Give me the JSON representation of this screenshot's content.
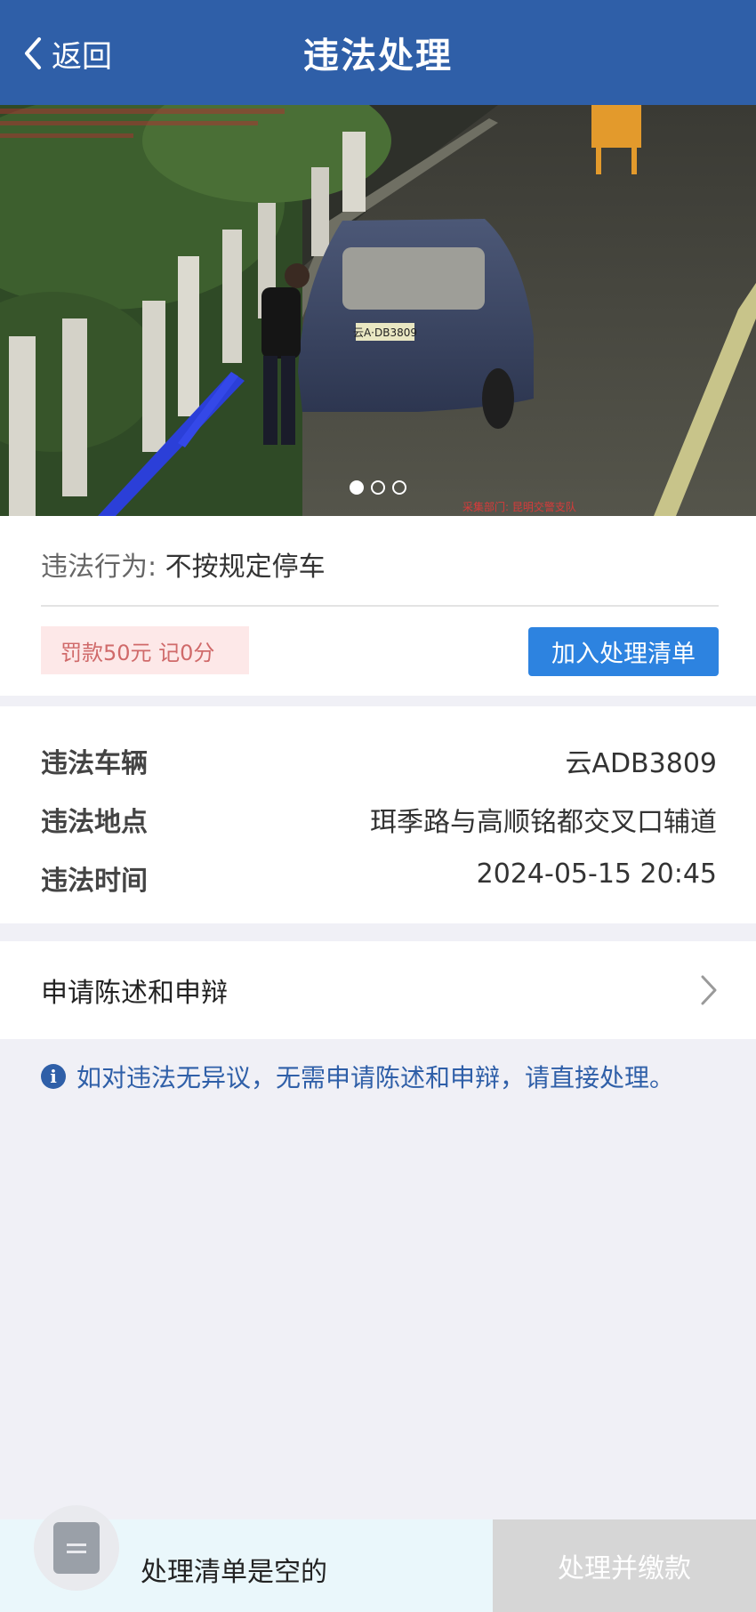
{
  "header": {
    "back_label": "返回",
    "title": "违法处理"
  },
  "photo": {
    "plate_text": "云A·DB3809",
    "watermark": "采集部门: 昆明交警支队",
    "slide_count": 3,
    "active_slide": 1
  },
  "violation": {
    "behavior_key": "违法行为:",
    "behavior_value": "不按规定停车",
    "fine_badge": "罚款50元 记0分",
    "add_button": "加入处理清单"
  },
  "details": {
    "rows": [
      {
        "label": "违法车辆",
        "value": "云ADB3809"
      },
      {
        "label": "违法地点",
        "value": "珥季路与高顺铭都交叉口辅道"
      },
      {
        "label": "违法时间",
        "value": "2024-05-15 20:45"
      }
    ]
  },
  "appeal": {
    "label": "申请陈述和申辩"
  },
  "notice": {
    "icon": "info-icon",
    "text": "如对违法无异议，无需申请陈述和申辩，请直接处理。"
  },
  "bottom": {
    "empty_text": "处理清单是空的",
    "pay_button": "处理并缴款"
  },
  "colors": {
    "header": "#2f5fa8",
    "primary_button": "#2d83e0",
    "fine_bg": "#fde8e8",
    "fine_text": "#d06a6a",
    "pay_button_disabled": "#d6d6d6"
  }
}
